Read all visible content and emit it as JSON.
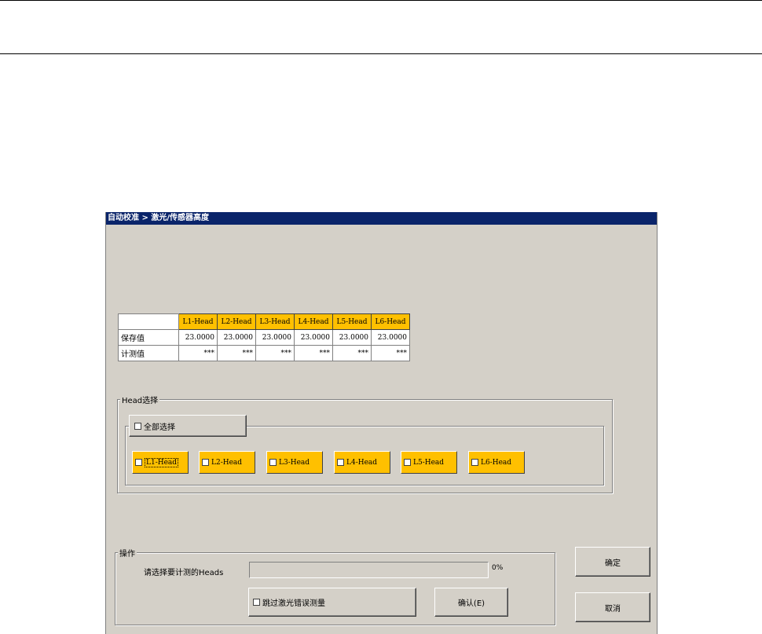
{
  "window": {
    "title": "自动校准 > 激光/传感器高度"
  },
  "table": {
    "headers": [
      "L1-Head",
      "L2-Head",
      "L3-Head",
      "L4-Head",
      "L5-Head",
      "L6-Head"
    ],
    "rows": [
      {
        "label": "保存值",
        "values": [
          "23.0000",
          "23.0000",
          "23.0000",
          "23.0000",
          "23.0000",
          "23.0000"
        ]
      },
      {
        "label": "计测值",
        "values": [
          "***",
          "***",
          "***",
          "***",
          "***",
          "***"
        ]
      }
    ]
  },
  "head_select": {
    "group_title": "Head选择",
    "select_all_label": "全部选择",
    "heads": [
      "L1-Head",
      "L2-Head",
      "L3-Head",
      "L4-Head",
      "L5-Head",
      "L6-Head"
    ]
  },
  "operation": {
    "group_title": "操作",
    "prompt": "请选择要计测的Heads",
    "progress_percent": 0,
    "progress_text": "0%",
    "skip_label": "跳过激光错误测量",
    "confirm_label": "确认(E)"
  },
  "buttons": {
    "ok": "确定",
    "cancel": "取消"
  },
  "colors": {
    "title_bar": "#0a246a",
    "head_highlight": "#ffc000",
    "dialog_bg": "#d4d0c8"
  }
}
